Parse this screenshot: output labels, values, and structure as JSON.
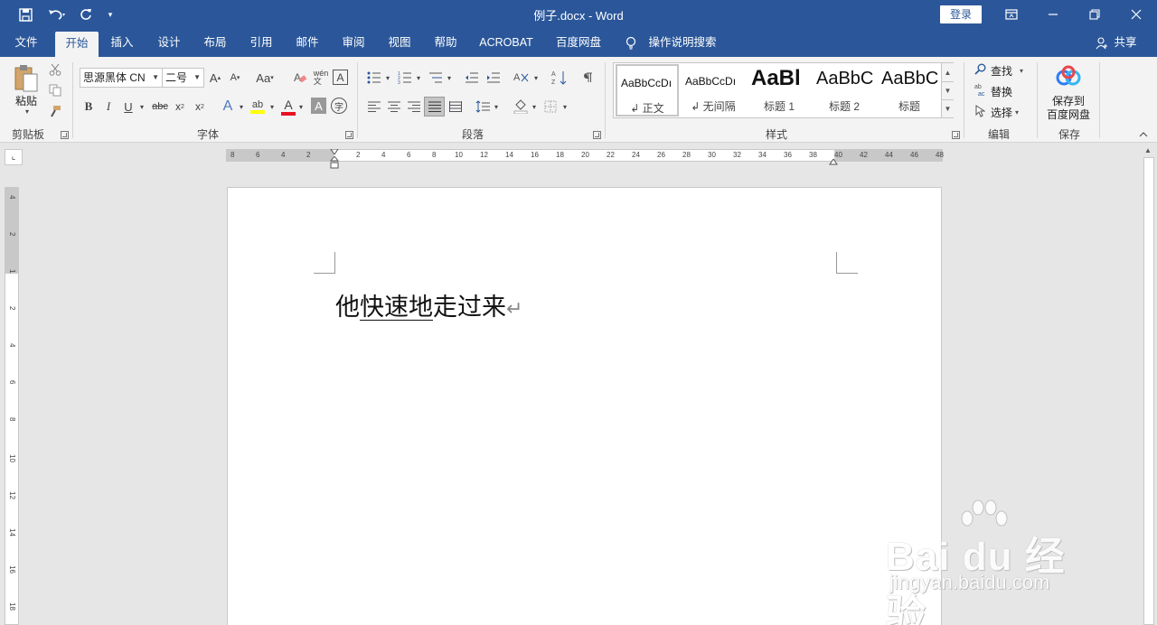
{
  "window": {
    "title": "例子.docx  -  Word",
    "login_label": "登录"
  },
  "tabs": [
    "文件",
    "开始",
    "插入",
    "设计",
    "布局",
    "引用",
    "邮件",
    "审阅",
    "视图",
    "帮助",
    "ACROBAT",
    "百度网盘"
  ],
  "active_tab": "开始",
  "tell_me": "操作说明搜索",
  "share_label": "共享",
  "ribbon": {
    "clipboard": {
      "paste_label": "粘贴",
      "group_label": "剪贴板"
    },
    "font": {
      "font_name": "思源黑体 CN",
      "font_size": "二号",
      "group_label": "字体"
    },
    "paragraph": {
      "group_label": "段落"
    },
    "styles": {
      "group_label": "样式",
      "items": [
        {
          "sample": "AaBbCcDı",
          "name": "↲ 正文"
        },
        {
          "sample": "AaBbCcDı",
          "name": "↲ 无间隔"
        },
        {
          "sample": "AaBl",
          "name": "标题 1"
        },
        {
          "sample": "AaBbC",
          "name": "标题 2"
        },
        {
          "sample": "AaBbC",
          "name": "标题"
        }
      ]
    },
    "editing": {
      "group_label": "编辑",
      "find": "查找",
      "replace": "替换",
      "select": "选择"
    },
    "save": {
      "group_label": "保存",
      "line1": "保存到",
      "line2": "百度网盘"
    }
  },
  "ruler": {
    "left_ticks": [
      "8",
      "6",
      "4",
      "2"
    ],
    "ticks": [
      "2",
      "4",
      "6",
      "8",
      "10",
      "12",
      "14",
      "16",
      "18",
      "20",
      "22",
      "24",
      "26",
      "28",
      "30",
      "32",
      "34",
      "36",
      "38",
      "40",
      "42",
      "44",
      "46",
      "48"
    ],
    "vticks": [
      "4",
      "2",
      "1",
      "2",
      "4",
      "6",
      "8",
      "10",
      "12",
      "14",
      "16",
      "18"
    ]
  },
  "document": {
    "text_before": "他",
    "text_underlined": "快速地",
    "text_after": "走过来",
    "para_mark": "↵"
  },
  "watermark": {
    "brand": "Bai du 经验",
    "url": "jingyan.baidu.com"
  },
  "colors": {
    "title_bar": "#2b579a",
    "ribbon_bg": "#f3f3f3",
    "canvas_bg": "#e6e6e6",
    "font_color_swatch": "#e81123",
    "highlight_swatch": "#ffff00"
  }
}
